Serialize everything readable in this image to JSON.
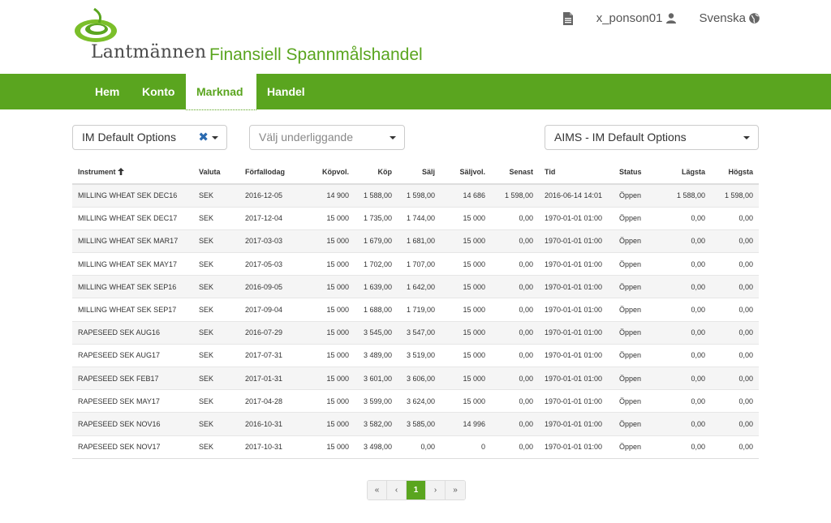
{
  "header": {
    "logo_text": "Lantmännen",
    "app_title": "Finansiell Spannmålshandel",
    "username": "x_ponson01",
    "language": "Svenska",
    "brand_color": "#5aa51f"
  },
  "nav": {
    "items": [
      "Hem",
      "Konto",
      "Marknad",
      "Handel"
    ],
    "active": "Marknad"
  },
  "filters": {
    "options_select": "IM Default Options",
    "underlying_placeholder": "Välj underliggande",
    "aims_select": "AIMS - IM Default Options"
  },
  "table": {
    "columns": [
      "Instrument",
      "Valuta",
      "Förfallodag",
      "Köpvol.",
      "Köp",
      "Sälj",
      "Säljvol.",
      "Senast",
      "Tid",
      "Status",
      "Lägsta",
      "Högsta"
    ],
    "rows": [
      [
        "MILLING WHEAT SEK DEC16",
        "SEK",
        "2016-12-05",
        "14 900",
        "1 588,00",
        "1 598,00",
        "14 686",
        "1 598,00",
        "2016-06-14 14:01",
        "Öppen",
        "1 588,00",
        "1 598,00"
      ],
      [
        "MILLING WHEAT SEK DEC17",
        "SEK",
        "2017-12-04",
        "15 000",
        "1 735,00",
        "1 744,00",
        "15 000",
        "0,00",
        "1970-01-01 01:00",
        "Öppen",
        "0,00",
        "0,00"
      ],
      [
        "MILLING WHEAT SEK MAR17",
        "SEK",
        "2017-03-03",
        "15 000",
        "1 679,00",
        "1 681,00",
        "15 000",
        "0,00",
        "1970-01-01 01:00",
        "Öppen",
        "0,00",
        "0,00"
      ],
      [
        "MILLING WHEAT SEK MAY17",
        "SEK",
        "2017-05-03",
        "15 000",
        "1 702,00",
        "1 707,00",
        "15 000",
        "0,00",
        "1970-01-01 01:00",
        "Öppen",
        "0,00",
        "0,00"
      ],
      [
        "MILLING WHEAT SEK SEP16",
        "SEK",
        "2016-09-05",
        "15 000",
        "1 639,00",
        "1 642,00",
        "15 000",
        "0,00",
        "1970-01-01 01:00",
        "Öppen",
        "0,00",
        "0,00"
      ],
      [
        "MILLING WHEAT SEK SEP17",
        "SEK",
        "2017-09-04",
        "15 000",
        "1 688,00",
        "1 719,00",
        "15 000",
        "0,00",
        "1970-01-01 01:00",
        "Öppen",
        "0,00",
        "0,00"
      ],
      [
        "RAPESEED SEK AUG16",
        "SEK",
        "2016-07-29",
        "15 000",
        "3 545,00",
        "3 547,00",
        "15 000",
        "0,00",
        "1970-01-01 01:00",
        "Öppen",
        "0,00",
        "0,00"
      ],
      [
        "RAPESEED SEK AUG17",
        "SEK",
        "2017-07-31",
        "15 000",
        "3 489,00",
        "3 519,00",
        "15 000",
        "0,00",
        "1970-01-01 01:00",
        "Öppen",
        "0,00",
        "0,00"
      ],
      [
        "RAPESEED SEK FEB17",
        "SEK",
        "2017-01-31",
        "15 000",
        "3 601,00",
        "3 606,00",
        "15 000",
        "0,00",
        "1970-01-01 01:00",
        "Öppen",
        "0,00",
        "0,00"
      ],
      [
        "RAPESEED SEK MAY17",
        "SEK",
        "2017-04-28",
        "15 000",
        "3 599,00",
        "3 624,00",
        "15 000",
        "0,00",
        "1970-01-01 01:00",
        "Öppen",
        "0,00",
        "0,00"
      ],
      [
        "RAPESEED SEK NOV16",
        "SEK",
        "2016-10-31",
        "15 000",
        "3 582,00",
        "3 585,00",
        "14 996",
        "0,00",
        "1970-01-01 01:00",
        "Öppen",
        "0,00",
        "0,00"
      ],
      [
        "RAPESEED SEK NOV17",
        "SEK",
        "2017-10-31",
        "15 000",
        "3 498,00",
        "0,00",
        "0",
        "0,00",
        "1970-01-01 01:00",
        "Öppen",
        "0,00",
        "0,00"
      ]
    ]
  },
  "pagination": {
    "first": "«",
    "prev": "‹",
    "current": "1",
    "next": "›",
    "last": "»"
  }
}
